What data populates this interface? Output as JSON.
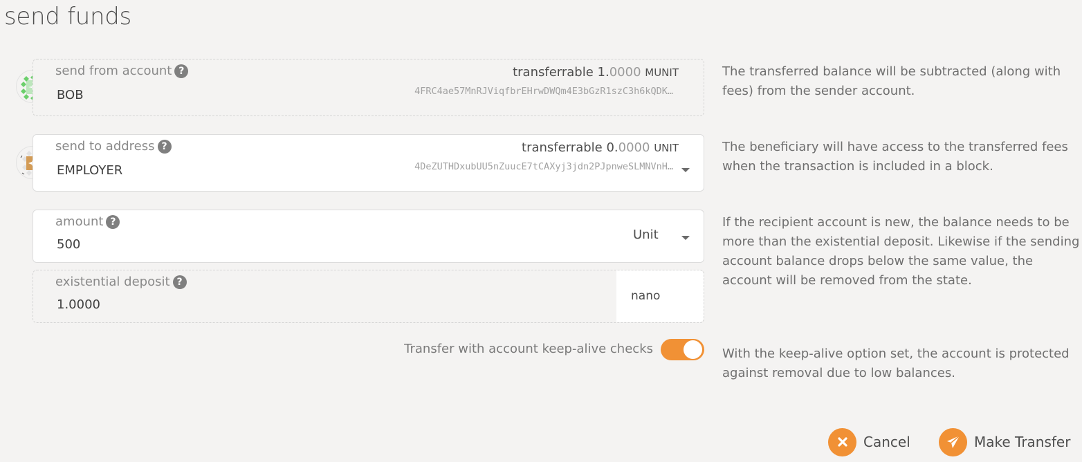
{
  "page": {
    "title": "send funds"
  },
  "from": {
    "label": "send from account",
    "help_icon": "question-circle-icon",
    "account_name": "BOB",
    "balance_label": "transferrable",
    "balance_int": "1.",
    "balance_dec": "0000",
    "balance_unit": "MUNIT",
    "address": "4FRC4ae57MnRJViqfbrEHrwDWQm4E3bGzR1szC3h6kQDK…",
    "identicon_color": "#6bcf6b",
    "help_text": "The transferred balance will be subtracted (along with fees) from the sender account."
  },
  "to": {
    "label": "send to address",
    "help_icon": "question-circle-icon",
    "account_name": "EMPLOYER",
    "balance_label": "transferrable",
    "balance_int": "0.",
    "balance_dec": "0000",
    "balance_unit": "UNIT",
    "address": "4DeZUTHDxubUU5nZuucE7tCAXyj3jdn2PJpnweSLMNVnH…",
    "identicon_color": "#d39b55",
    "help_text": "The beneficiary will have access to the transferred fees when the transaction is included in a block."
  },
  "amount": {
    "label": "amount",
    "help_icon": "question-circle-icon",
    "value": "500",
    "unit_selected": "Unit"
  },
  "existential_deposit": {
    "label": "existential deposit",
    "help_icon": "question-circle-icon",
    "value": "1.0000",
    "unit": "nano",
    "help_text": "If the recipient account is new, the balance needs to be more than the existential deposit. Likewise if the sending account balance drops below the same value, the account will be removed from the state."
  },
  "keep_alive": {
    "label": "Transfer with account keep-alive checks",
    "enabled": true,
    "help_text": "With the keep-alive option set, the account is protected against removal due to low balances."
  },
  "actions": {
    "cancel_label": "Cancel",
    "cancel_icon": "close-icon",
    "submit_label": "Make Transfer",
    "submit_icon": "paper-plane-icon"
  },
  "colors": {
    "accent": "#f19135",
    "background": "#f4f3f2",
    "text": "#4e4e4e",
    "muted": "#8a8a8a"
  }
}
